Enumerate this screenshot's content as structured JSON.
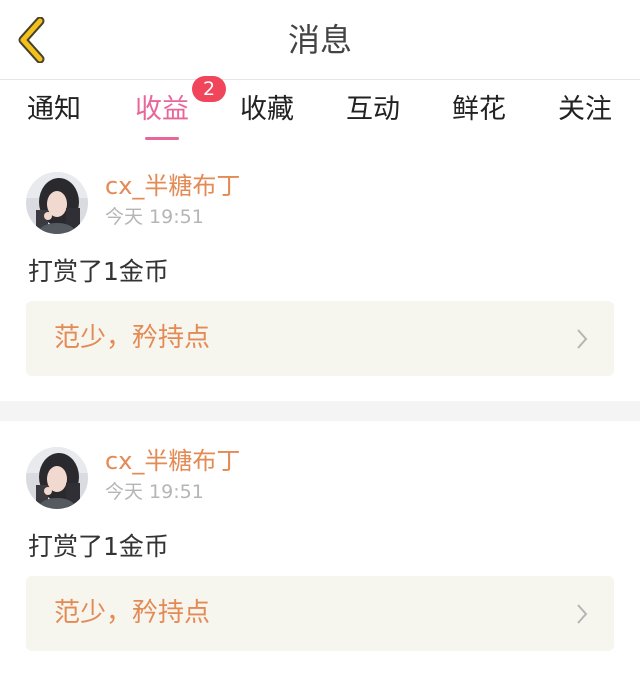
{
  "header": {
    "back_icon": "chevron-left-icon",
    "title": "消息"
  },
  "tabs": [
    {
      "label": "通知",
      "active": false
    },
    {
      "label": "收益",
      "active": true,
      "badge": "2"
    },
    {
      "label": "收藏",
      "active": false
    },
    {
      "label": "互动",
      "active": false
    },
    {
      "label": "鲜花",
      "active": false
    },
    {
      "label": "关注",
      "active": false
    }
  ],
  "messages": [
    {
      "username": "cx_半糖布丁",
      "time": "今天 19:51",
      "text": "打赏了1金币",
      "quote": "范少，矜持点"
    },
    {
      "username": "cx_半糖布丁",
      "time": "今天 19:51",
      "text": "打赏了1金币",
      "quote": "范少，矜持点"
    }
  ],
  "colors": {
    "accent_pink": "#e8679a",
    "accent_orange": "#e38a55",
    "badge_red": "#f0455a",
    "back_icon_yellow": "#f2c21a"
  }
}
